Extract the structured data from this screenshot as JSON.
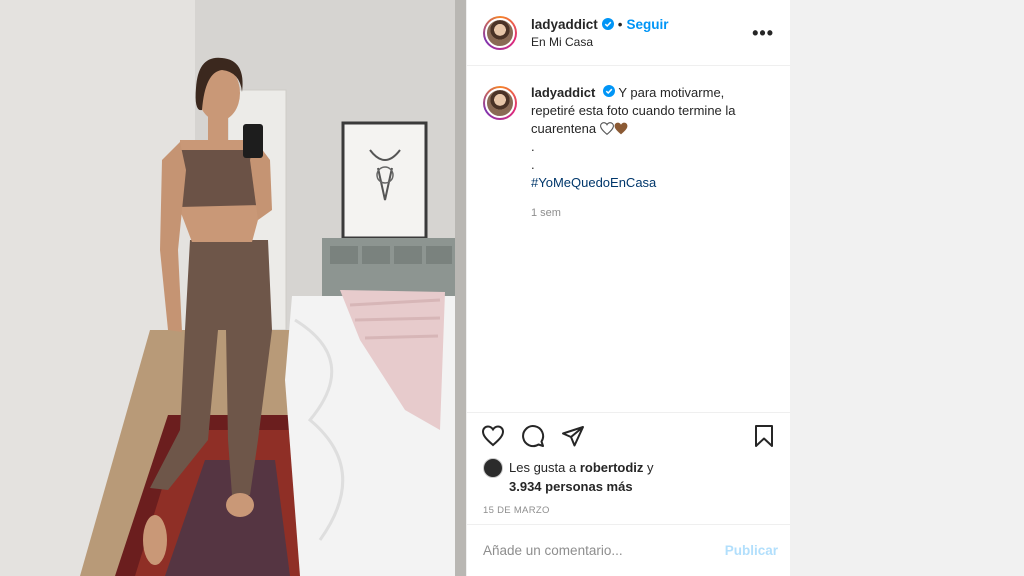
{
  "post": {
    "username": "ladyaddict",
    "follow_label": "Seguir",
    "separator": "•",
    "location": "En Mi Casa",
    "more_label": "•••",
    "caption": {
      "username": "ladyaddict",
      "line1": "Y para motivarme,",
      "line2": "repetiré esta foto cuando termine la",
      "line3": "cuarentena",
      "dot1": ".",
      "dot2": ".",
      "hashtag": "#YoMeQuedoEnCasa",
      "age": "1 sem"
    },
    "likes": {
      "prefix": "Les gusta a",
      "liker": "robertodiz",
      "suffix": "y",
      "count": "3.934 personas más"
    },
    "date": "15 DE MARZO",
    "comment_placeholder": "Añade un comentario...",
    "publish_label": "Publicar"
  },
  "icons": {
    "verified": "verified-badge-icon",
    "like": "heart-icon",
    "comment": "comment-icon",
    "share": "paper-plane-icon",
    "save": "bookmark-icon"
  },
  "colors": {
    "accent": "#0095f6",
    "hashtag": "#00376b",
    "muted": "#8e8e8e",
    "publish_disabled": "#b2dffc"
  }
}
